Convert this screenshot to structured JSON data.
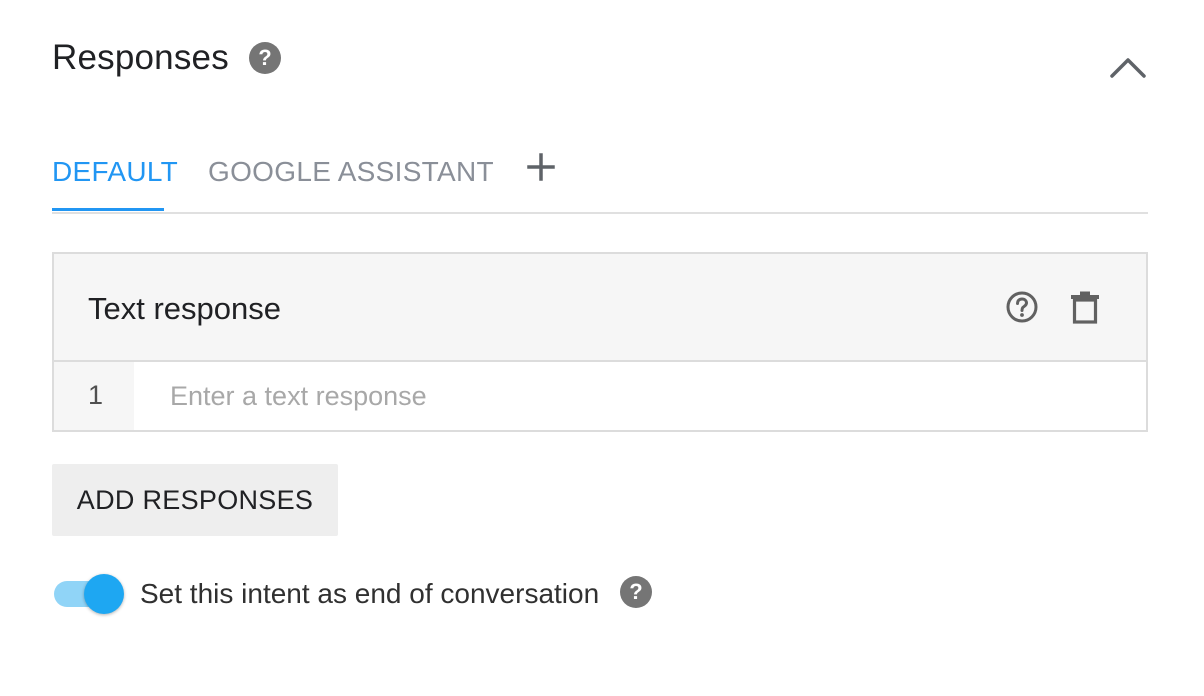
{
  "header": {
    "title": "Responses",
    "help_icon": "?",
    "collapse_icon": "chevron-up-icon"
  },
  "tabs": [
    {
      "label": "DEFAULT",
      "active": true
    },
    {
      "label": "GOOGLE ASSISTANT",
      "active": false
    }
  ],
  "add_tab_icon": "plus-icon",
  "card": {
    "title": "Text response",
    "help_icon": "help-circle-outline-icon",
    "delete_icon": "trash-icon",
    "rows": [
      {
        "number": "1",
        "placeholder": "Enter a text response",
        "value": ""
      }
    ]
  },
  "add_button": {
    "label": "ADD RESPONSES"
  },
  "end_conversation": {
    "label": "Set this intent as end of conversation",
    "enabled": true,
    "help_icon": "?"
  },
  "colors": {
    "accent": "#2196f3",
    "toggle_thumb": "#1ea7f2",
    "toggle_track": "#90d4f7",
    "inactive_tab": "#8a8f98",
    "icon_gray": "#757575"
  }
}
